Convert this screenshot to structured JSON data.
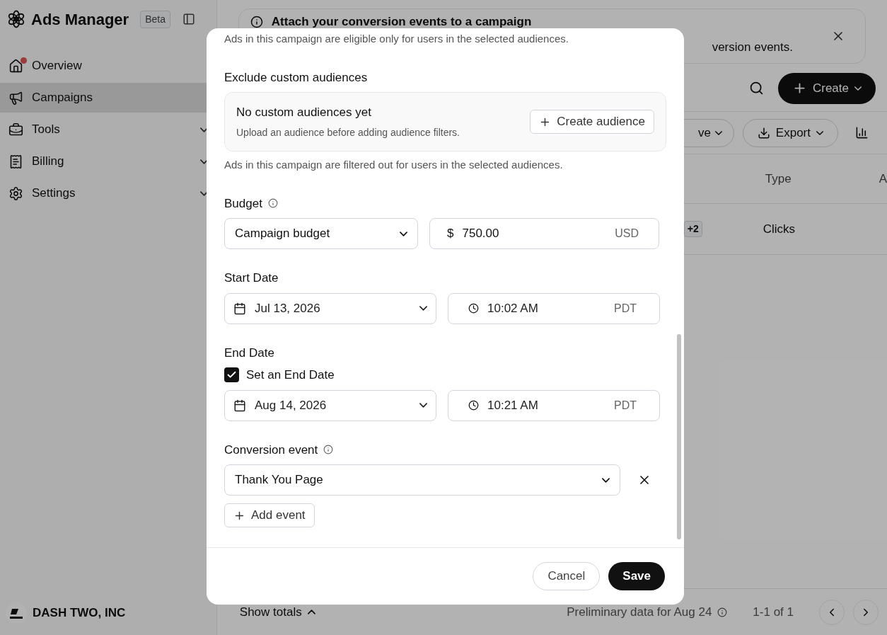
{
  "app": {
    "title": "Ads Manager",
    "badge": "Beta"
  },
  "sidebar": {
    "items": [
      {
        "label": "Overview",
        "selected": false,
        "notification": true,
        "expandable": false
      },
      {
        "label": "Campaigns",
        "selected": true,
        "notification": false,
        "expandable": false
      },
      {
        "label": "Tools",
        "selected": false,
        "notification": false,
        "expandable": true
      },
      {
        "label": "Billing",
        "selected": false,
        "notification": false,
        "expandable": true
      },
      {
        "label": "Settings",
        "selected": false,
        "notification": false,
        "expandable": true
      }
    ]
  },
  "account": {
    "name": "DASH TWO, INC"
  },
  "banner": {
    "title": "Attach your conversion events to a campaign",
    "text": "version events."
  },
  "toolbar": {
    "create": "Create",
    "filter": "ve",
    "export": "Export"
  },
  "table": {
    "columns": [
      "Type",
      "A"
    ],
    "rows": [
      {
        "badge": "+2",
        "type": "Clicks"
      }
    ]
  },
  "footer": {
    "show_totals": "Show totals",
    "note": "Preliminary data for Aug 24",
    "pagination": "1-1 of 1"
  },
  "dialog": {
    "include_note": "Ads in this campaign are eligible only for users in the selected audiences.",
    "exclude": {
      "label": "Exclude custom audiences",
      "empty_title": "No custom audiences yet",
      "empty_text": "Upload an audience before adding audience filters.",
      "button": "Create audience",
      "note": "Ads in this campaign are filtered out for users in the selected audiences."
    },
    "budget": {
      "label": "Budget",
      "type": "Campaign budget",
      "currency_symbol": "$",
      "amount": "750.00",
      "currency": "USD"
    },
    "start": {
      "label": "Start Date",
      "date": "Jul 13, 2026",
      "time": "10:02 AM",
      "timezone": "PDT"
    },
    "end": {
      "label": "End Date",
      "checkbox_label": "Set an End Date",
      "checked": true,
      "date": "Aug 14, 2026",
      "time": "10:21 AM",
      "timezone": "PDT"
    },
    "conversion": {
      "label": "Conversion event",
      "events": [
        "Thank You Page"
      ],
      "add": "Add event"
    },
    "cancel": "Cancel",
    "save": "Save"
  }
}
